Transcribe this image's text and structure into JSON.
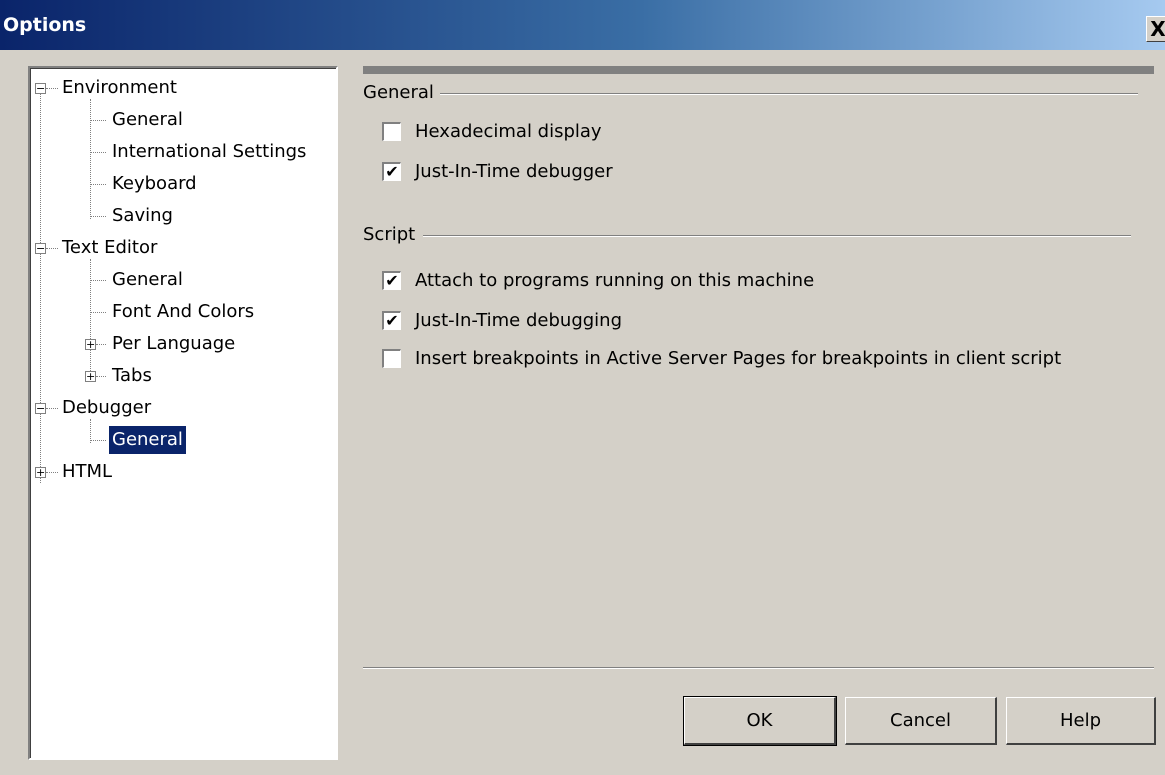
{
  "window": {
    "title": "Options",
    "close_label": "X"
  },
  "tree": {
    "items": [
      {
        "label": "Environment",
        "expander": "−"
      },
      {
        "label": "General"
      },
      {
        "label": "International Settings"
      },
      {
        "label": "Keyboard"
      },
      {
        "label": "Saving"
      },
      {
        "label": "Text Editor",
        "expander": "−"
      },
      {
        "label": "General"
      },
      {
        "label": "Font And Colors"
      },
      {
        "label": "Per Language",
        "expander": "+"
      },
      {
        "label": "Tabs",
        "expander": "+"
      },
      {
        "label": "Debugger",
        "expander": "−"
      },
      {
        "label": "General",
        "selected": true
      },
      {
        "label": "HTML",
        "expander": "+"
      }
    ]
  },
  "general_group": {
    "title": "General",
    "options": [
      {
        "label": "Hexadecimal display",
        "checked": false,
        "mark": ""
      },
      {
        "label": "Just-In-Time debugger",
        "checked": true,
        "mark": "✔"
      }
    ]
  },
  "script_group": {
    "title": "Script",
    "options": [
      {
        "label": "Attach to programs running on this machine",
        "checked": true,
        "mark": "✔"
      },
      {
        "label": "Just-In-Time debugging",
        "checked": true,
        "mark": "✔"
      },
      {
        "label": "Insert breakpoints in Active Server Pages for breakpoints in client script",
        "checked": false,
        "mark": ""
      }
    ]
  },
  "buttons": {
    "ok": "OK",
    "cancel": "Cancel",
    "help": "Help"
  }
}
